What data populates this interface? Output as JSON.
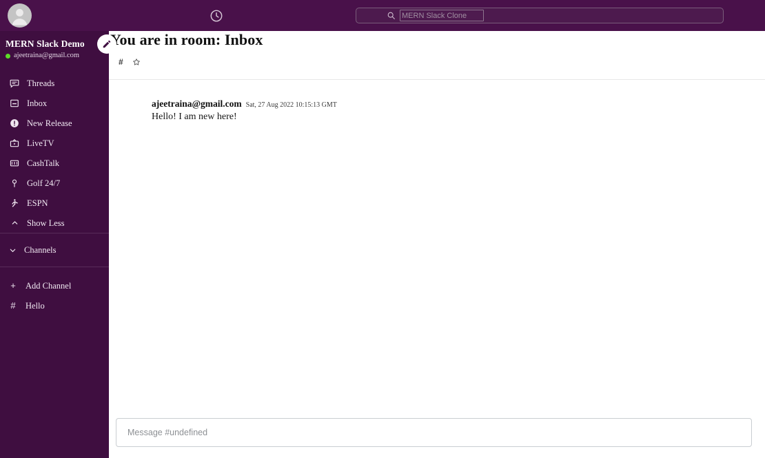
{
  "topbar": {
    "avatar_name": "user-avatar",
    "history_icon": "clock-icon",
    "search": {
      "icon": "search-icon",
      "placeholder": "MERN Slack Clone",
      "value": ""
    }
  },
  "sidebar": {
    "workspace_name": "MERN Slack Demo",
    "user_email": "ajeetraina@gmail.com",
    "compose_label": "",
    "nav_items": [
      {
        "label": "Threads",
        "icon": "threads-icon"
      },
      {
        "label": "Inbox",
        "icon": "inbox-icon"
      },
      {
        "label": "New Release",
        "icon": "new-release-icon"
      },
      {
        "label": "LiveTV",
        "icon": "live-tv-icon"
      },
      {
        "label": "CashTalk",
        "icon": "cash-talk-icon"
      },
      {
        "label": "Golf 24/7",
        "icon": "golf-icon"
      },
      {
        "label": "ESPN",
        "icon": "espn-icon"
      },
      {
        "label": "Show Less",
        "icon": "chevron-up-icon"
      }
    ],
    "channels_section": {
      "label": "Channels",
      "icon": "chevron-down-icon"
    },
    "channel_actions": [
      {
        "label": "Add Channel",
        "icon": "plus-icon"
      },
      {
        "label": "Hello",
        "icon": "hash-icon"
      }
    ]
  },
  "main": {
    "room_title": "You are in room: Inbox",
    "channel_hash": "#",
    "star_icon": "star-outline-icon",
    "messages": [
      {
        "author": "ajeetraina@gmail.com",
        "timestamp": "Sat, 27 Aug 2022 10:15:13 GMT",
        "text": "Hello! I am new here!"
      }
    ],
    "composer": {
      "placeholder": "Message #undefined",
      "value": ""
    }
  },
  "colors": {
    "topbar": "#49114A",
    "sidebar": "#3F0E40",
    "online": "#5ddc28",
    "main_bg": "#ffffff"
  }
}
